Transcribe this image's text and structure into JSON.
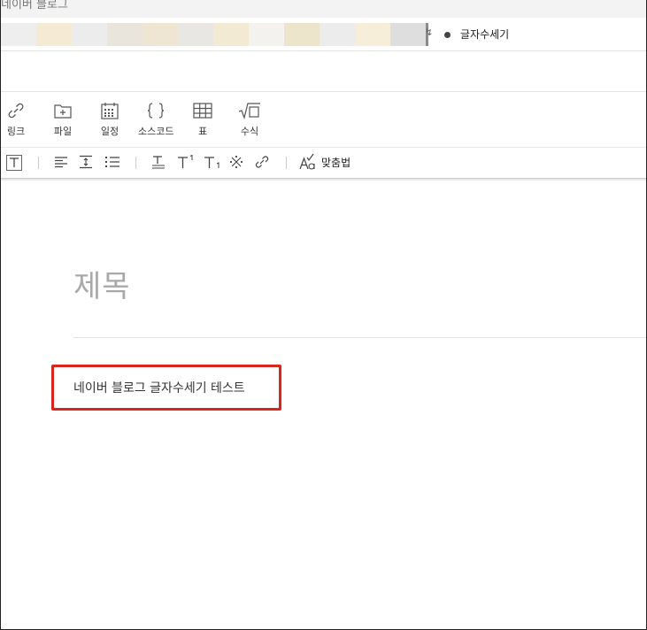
{
  "window": {
    "tab_title": "네이버 블로그"
  },
  "address_bar": {
    "extension_mark": "↯",
    "extension_label": "글자수세기",
    "swatch_colors": [
      "#eeeeee",
      "#f5ead3",
      "#ececec",
      "#eae5dc",
      "#eee5d2",
      "#e8e7e4",
      "#f3ead3",
      "#f3f2ee",
      "#ede4cc",
      "#ececec",
      "#f7eed9",
      "#dedede"
    ]
  },
  "insert_toolbar": {
    "items": [
      {
        "label": "링크",
        "icon": "link-icon"
      },
      {
        "label": "파일",
        "icon": "file-icon"
      },
      {
        "label": "일정",
        "icon": "calendar-icon"
      },
      {
        "label": "소스코드",
        "icon": "code-icon"
      },
      {
        "label": "표",
        "icon": "table-icon"
      },
      {
        "label": "수식",
        "icon": "formula-icon"
      }
    ]
  },
  "format_toolbar": {
    "spellcheck_label": "맞춤법"
  },
  "document": {
    "title_placeholder": "제목",
    "body_text": "네이버 블로그 글자수세기 테스트"
  },
  "colors": {
    "highlight_border": "#d9251c",
    "placeholder": "#a9a9a9"
  }
}
